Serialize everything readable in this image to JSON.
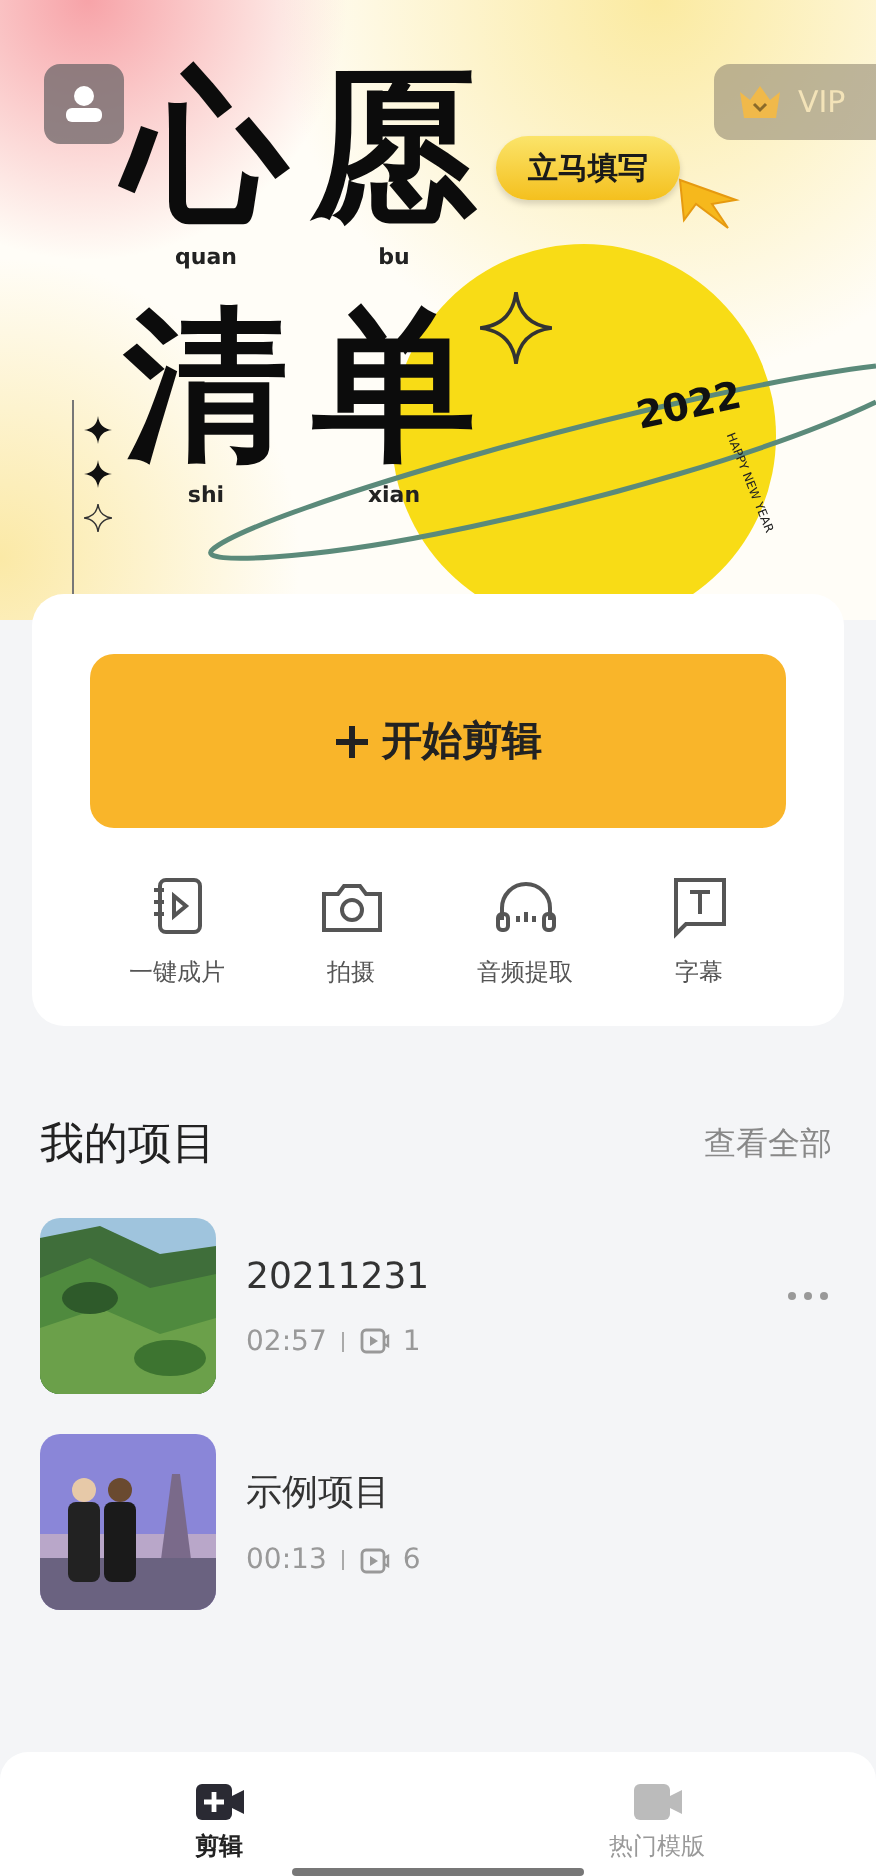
{
  "header": {
    "vip_label": "VIP"
  },
  "banner": {
    "title_rows": [
      [
        {
          "char": "心",
          "pinyin": "quan"
        },
        {
          "char": "愿",
          "pinyin": "bu"
        }
      ],
      [
        {
          "char": "清",
          "pinyin": "shi"
        },
        {
          "char": "单",
          "pinyin": "xian"
        }
      ]
    ],
    "cta": "立马填写",
    "year": "2022",
    "tagline": "HAPPY NEW YEAR"
  },
  "start_button": {
    "label": "开始剪辑"
  },
  "tools": [
    {
      "kind": "oneclick",
      "label": "一键成片"
    },
    {
      "kind": "camera",
      "label": "拍摄"
    },
    {
      "kind": "audio",
      "label": "音频提取"
    },
    {
      "kind": "subtitle",
      "label": "字幕"
    }
  ],
  "projects": {
    "title": "我的项目",
    "view_all": "查看全部",
    "items": [
      {
        "name": "20211231",
        "duration": "02:57",
        "clips": "1",
        "has_menu": true
      },
      {
        "name": "示例项目",
        "duration": "00:13",
        "clips": "6",
        "has_menu": false
      }
    ]
  },
  "tabs": [
    {
      "label": "剪辑",
      "selected": true
    },
    {
      "label": "热门模版",
      "selected": false
    }
  ]
}
